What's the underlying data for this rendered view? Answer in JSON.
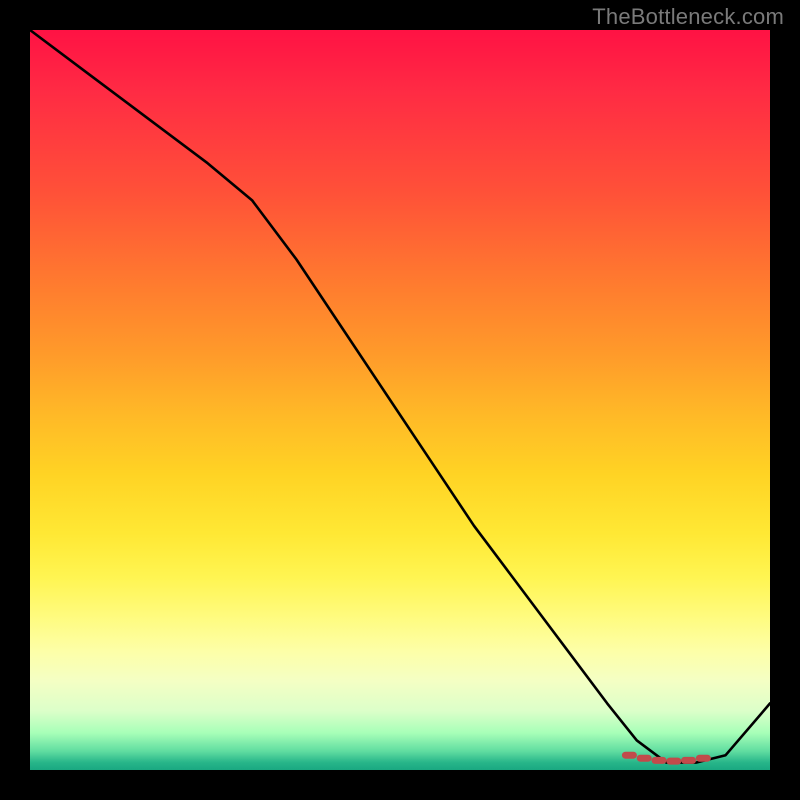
{
  "watermark": "TheBottleneck.com",
  "chart_data": {
    "type": "line",
    "title": "",
    "xlabel": "",
    "ylabel": "",
    "xlim": [
      0,
      100
    ],
    "ylim": [
      0,
      100
    ],
    "grid": false,
    "legend": false,
    "series": [
      {
        "name": "curve",
        "x": [
          0,
          8,
          16,
          24,
          30,
          36,
          42,
          48,
          54,
          60,
          66,
          72,
          78,
          82,
          86,
          90,
          94,
          100
        ],
        "values": [
          100,
          94,
          88,
          82,
          77,
          69,
          60,
          51,
          42,
          33,
          25,
          17,
          9,
          4,
          1,
          1,
          2,
          9
        ]
      }
    ],
    "markers": {
      "name": "optimal-range",
      "x": [
        81,
        83,
        85,
        87,
        89,
        91
      ],
      "values": [
        2.0,
        1.6,
        1.3,
        1.2,
        1.3,
        1.6
      ]
    },
    "colors": {
      "curve": "#000000",
      "markers": "#c14b4b"
    }
  }
}
